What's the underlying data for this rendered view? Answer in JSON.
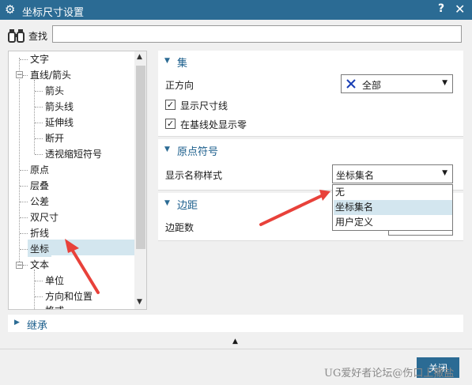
{
  "window": {
    "title": "坐标尺寸设置",
    "help": "?",
    "close": "✕"
  },
  "find": {
    "label": "查找",
    "value": ""
  },
  "tree": {
    "items": [
      {
        "label": "文字",
        "level": 0
      },
      {
        "label": "直线/箭头",
        "level": 0,
        "toggle": "−"
      },
      {
        "label": "箭头",
        "level": 1
      },
      {
        "label": "箭头线",
        "level": 1
      },
      {
        "label": "延伸线",
        "level": 1
      },
      {
        "label": "断开",
        "level": 1
      },
      {
        "label": "透视缩短符号",
        "level": 1
      },
      {
        "label": "原点",
        "level": 0
      },
      {
        "label": "层叠",
        "level": 0
      },
      {
        "label": "公差",
        "level": 0
      },
      {
        "label": "双尺寸",
        "level": 0
      },
      {
        "label": "折线",
        "level": 0
      },
      {
        "label": "坐标",
        "level": 0,
        "selected": true
      },
      {
        "label": "文本",
        "level": 0,
        "toggle": "−"
      },
      {
        "label": "单位",
        "level": 1
      },
      {
        "label": "方向和位置",
        "level": 1
      },
      {
        "label": "格式",
        "level": 1
      }
    ]
  },
  "set_section": {
    "title": "集",
    "direction_label": "正方向",
    "direction_value": "全部",
    "show_dim_line": "显示尺寸线",
    "show_zero": "在基线处显示零"
  },
  "origin_section": {
    "title": "原点符号",
    "style_label": "显示名称样式",
    "style_value": "坐标集名",
    "options": [
      "无",
      "坐标集名",
      "用户定义"
    ]
  },
  "margin_section": {
    "title": "边距",
    "count_label": "边距数"
  },
  "inherit": {
    "title": "继承"
  },
  "buttons": {
    "close": "关闭"
  },
  "watermark": "UG爱好者论坛@伤口上撒盐",
  "colors": {
    "titlebar": "#2b6b94",
    "selection": "#d3e6ef",
    "section_text": "#1b5e8c",
    "annotation_arrow": "#e8413a"
  }
}
